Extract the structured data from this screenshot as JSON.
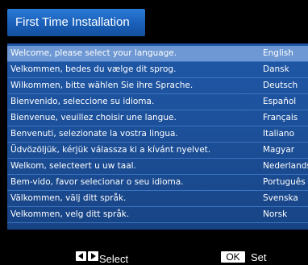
{
  "title": "First Time Installation",
  "languages": [
    {
      "message": "Welcome, please select your language.",
      "language": "English",
      "selected": true
    },
    {
      "message": "Velkommen, bedes du vælge dit sprog.",
      "language": "Dansk",
      "selected": false
    },
    {
      "message": "Wilkommen, bitte wählen Sie ihre Sprache.",
      "language": "Deutsch",
      "selected": false
    },
    {
      "message": "Bienvenido, seleccione su idioma.",
      "language": "Español",
      "selected": false
    },
    {
      "message": "Bienvenue, veuillez choisir une langue.",
      "language": "Français",
      "selected": false
    },
    {
      "message": "Benvenuti, selezionate la vostra lingua.",
      "language": "Italiano",
      "selected": false
    },
    {
      "message": "Üdvözöljük, kérjük válassza ki a kívánt nyelvet.",
      "language": "Magyar",
      "selected": false
    },
    {
      "message": "Welkom, selecteert u uw taal.",
      "language": "Nederlands",
      "selected": false
    },
    {
      "message": "Bem-vido, favor selecionar o seu idioma.",
      "language": "Português",
      "selected": false
    },
    {
      "message": "Välkommen, välj ditt språk.",
      "language": "Svenska",
      "selected": false
    },
    {
      "message": "Velkommen, velg ditt språk.",
      "language": "Norsk",
      "selected": false
    }
  ],
  "footer": {
    "select_label": "Select",
    "ok_key_label": "OK",
    "set_label": "Set"
  },
  "colors": {
    "title_bar": "#1a5fb8",
    "panel": "#1c4f98",
    "selected_row": "#6d98d3",
    "background": "#000000"
  }
}
